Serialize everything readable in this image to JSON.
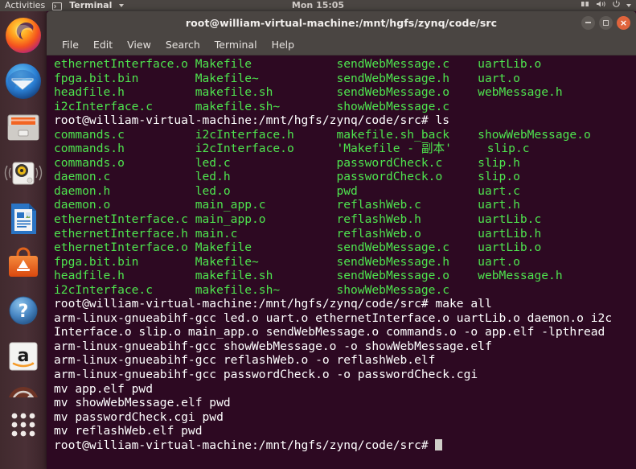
{
  "topbar": {
    "activities": "Activities",
    "app_name": "Terminal",
    "app_icon": "terminal-icon",
    "clock": "Mon 15:05",
    "indicators": [
      "network-icon",
      "volume-icon",
      "power-icon",
      "chevron-down-icon"
    ]
  },
  "launcher": {
    "items": [
      {
        "name": "firefox",
        "label": "Firefox Web Browser"
      },
      {
        "name": "thunderbird",
        "label": "Thunderbird Mail"
      },
      {
        "name": "files",
        "label": "Files"
      },
      {
        "name": "rhythmbox",
        "label": "Rhythmbox"
      },
      {
        "name": "libreoffice-writer",
        "label": "LibreOffice Writer"
      },
      {
        "name": "ubuntu-software",
        "label": "Ubuntu Software"
      },
      {
        "name": "help",
        "label": "Help"
      },
      {
        "name": "amazon",
        "label": "Amazon"
      },
      {
        "name": "system-settings",
        "label": "System Settings"
      },
      {
        "name": "show-applications",
        "label": "Show Applications"
      }
    ]
  },
  "window": {
    "title": "root@william-virtual-machine:/mnt/hgfs/zynq/code/src",
    "controls": {
      "minimize": "–",
      "maximize": "□",
      "close": "×"
    },
    "menu": [
      "File",
      "Edit",
      "View",
      "Search",
      "Terminal",
      "Help"
    ]
  },
  "terminal": {
    "prompt": "root@william-virtual-machine:/mnt/hgfs/zynq/code/src#",
    "colors": {
      "background": "#2d0922",
      "green": "#4ee44e",
      "white": "#ffffff"
    },
    "lines": [
      {
        "cols": [
          "ethernetInterface.o",
          "Makefile",
          "sendWebMessage.c",
          "uartLib.o"
        ],
        "color": "green"
      },
      {
        "cols": [
          "fpga.bit.bin",
          "Makefile~",
          "sendWebMessage.h",
          "uart.o"
        ],
        "color": "green"
      },
      {
        "cols": [
          "headfile.h",
          "makefile.sh",
          "sendWebMessage.o",
          "webMessage.h"
        ],
        "color": "green"
      },
      {
        "cols": [
          "i2cInterface.c",
          "makefile.sh~",
          "showWebMessage.c",
          ""
        ],
        "color": "green"
      },
      {
        "text": "root@william-virtual-machine:/mnt/hgfs/zynq/code/src# ls",
        "color": "white"
      },
      {
        "cols": [
          "commands.c",
          "i2cInterface.h",
          "makefile.sh_back",
          "showWebMessage.o"
        ],
        "color": "green"
      },
      {
        "cols": [
          "commands.h",
          "i2cInterface.o",
          "'Makefile - 副本'",
          "slip.c"
        ],
        "color": "green"
      },
      {
        "cols": [
          "commands.o",
          "led.c",
          "passwordCheck.c",
          "slip.h"
        ],
        "color": "green"
      },
      {
        "cols": [
          "daemon.c",
          "led.h",
          "passwordCheck.o",
          "slip.o"
        ],
        "color": "green"
      },
      {
        "cols": [
          "daemon.h",
          "led.o",
          "pwd",
          "uart.c"
        ],
        "color": "green"
      },
      {
        "cols": [
          "daemon.o",
          "main_app.c",
          "reflashWeb.c",
          "uart.h"
        ],
        "color": "green"
      },
      {
        "cols": [
          "ethernetInterface.c",
          "main_app.o",
          "reflashWeb.h",
          "uartLib.c"
        ],
        "color": "green"
      },
      {
        "cols": [
          "ethernetInterface.h",
          "main.c",
          "reflashWeb.o",
          "uartLib.h"
        ],
        "color": "green"
      },
      {
        "cols": [
          "ethernetInterface.o",
          "Makefile",
          "sendWebMessage.c",
          "uartLib.o"
        ],
        "color": "green"
      },
      {
        "cols": [
          "fpga.bit.bin",
          "Makefile~",
          "sendWebMessage.h",
          "uart.o"
        ],
        "color": "green"
      },
      {
        "cols": [
          "headfile.h",
          "makefile.sh",
          "sendWebMessage.o",
          "webMessage.h"
        ],
        "color": "green"
      },
      {
        "cols": [
          "i2cInterface.c",
          "makefile.sh~",
          "showWebMessage.c",
          ""
        ],
        "color": "green"
      },
      {
        "text": "root@william-virtual-machine:/mnt/hgfs/zynq/code/src# make all",
        "color": "white"
      },
      {
        "text": "arm-linux-gnueabihf-gcc led.o uart.o ethernetInterface.o uartLib.o daemon.o i2c",
        "color": "white"
      },
      {
        "text": "Interface.o slip.o main_app.o sendWebMessage.o commands.o -o app.elf -lpthread",
        "color": "white"
      },
      {
        "text": "arm-linux-gnueabihf-gcc showWebMessage.o -o showWebMessage.elf",
        "color": "white"
      },
      {
        "text": "arm-linux-gnueabihf-gcc reflashWeb.o -o reflashWeb.elf",
        "color": "white"
      },
      {
        "text": "arm-linux-gnueabihf-gcc passwordCheck.o -o passwordCheck.cgi",
        "color": "white"
      },
      {
        "text": "mv app.elf pwd",
        "color": "white"
      },
      {
        "text": "mv showWebMessage.elf pwd",
        "color": "white"
      },
      {
        "text": "mv passwordCheck.cgi pwd",
        "color": "white"
      },
      {
        "text": "mv reflashWeb.elf pwd",
        "color": "white"
      },
      {
        "text": "root@william-virtual-machine:/mnt/hgfs/zynq/code/src#",
        "color": "white",
        "cursor": true
      }
    ]
  }
}
